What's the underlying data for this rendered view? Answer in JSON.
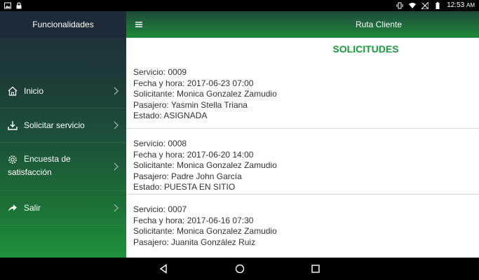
{
  "statusbar": {
    "time": "12:53",
    "ampm": "AM"
  },
  "sidebar": {
    "title": "Funcionalidades",
    "items": [
      {
        "label": "Inicio",
        "icon": "home-icon"
      },
      {
        "label": "Solicitar servicio",
        "icon": "download-icon"
      },
      {
        "label_line1": "Encuesta de",
        "label_line2": "satisfacción",
        "icon": "gear-icon"
      },
      {
        "label": "Salir",
        "icon": "share-icon"
      }
    ]
  },
  "topbar": {
    "title": "Ruta Cliente"
  },
  "main": {
    "heading": "SOLICITUDES",
    "requests": [
      {
        "servicio": "Servicio: 0009",
        "fecha": "Fecha y hora: 2017-06-23 07:00",
        "solicitante": "Solicitante: Monica Gonzalez Zamudio",
        "pasajero": "Pasajero: Yasmin Stella Triana",
        "estado": "Estado: ASIGNADA"
      },
      {
        "servicio": "Servicio: 0008",
        "fecha": "Fecha y hora: 2017-06-20 14:00",
        "solicitante": "Solicitante: Monica Gonzalez Zamudio",
        "pasajero": "Pasajero: Padre John García",
        "estado": "Estado: PUESTA EN SITIO"
      },
      {
        "servicio": "Servicio: 0007",
        "fecha": "Fecha y hora: 2017-06-16 07:30",
        "solicitante": "Solicitante: Monica Gonzalez Zamudio",
        "pasajero": "Pasajero: Juanita González Ruiz",
        "estado": ""
      }
    ]
  },
  "colors": {
    "accent": "#1a9b3c",
    "sidebar_dark": "#1c2b35"
  }
}
